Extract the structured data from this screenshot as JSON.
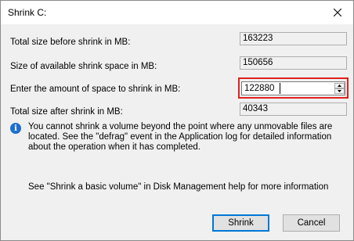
{
  "window": {
    "title": "Shrink C:"
  },
  "rows": [
    {
      "label": "Total size before shrink in MB:",
      "value": "163223"
    },
    {
      "label": "Size of available shrink space in MB:",
      "value": "150656"
    },
    {
      "label": "Enter the amount of space to shrink in MB:",
      "value": "122880"
    },
    {
      "label": "Total size after shrink in MB:",
      "value": "40343"
    }
  ],
  "info": {
    "icon": "info-icon",
    "message": "You cannot shrink a volume beyond the point where any unmovable files are located. See the \"defrag\" event in the Application log for detailed information about the operation when it has completed.",
    "help": "See \"Shrink a basic volume\" in Disk Management help for more information"
  },
  "buttons": {
    "shrink": "Shrink",
    "cancel": "Cancel"
  },
  "colors": {
    "highlight": "#e02020",
    "accent": "#0078d7",
    "info": "#1e6fd0"
  }
}
